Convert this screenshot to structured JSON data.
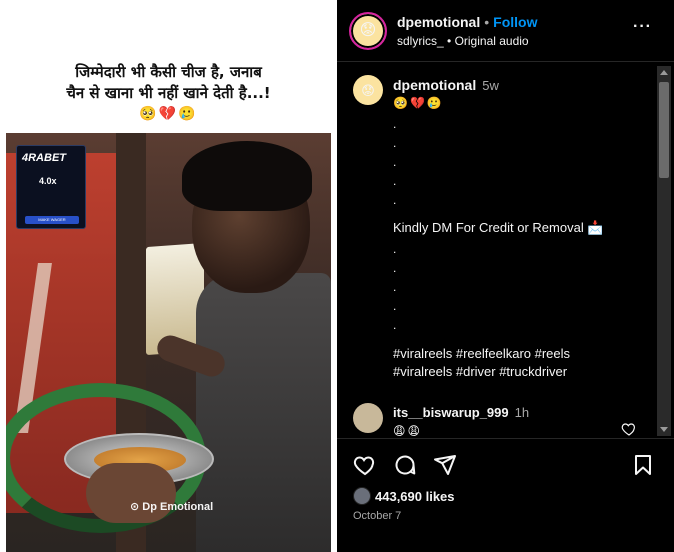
{
  "post": {
    "caption_line1": "जिम्मेदारी भी कैसी चीज है, जनाब",
    "caption_line2": "चैन से खाना भी नहीं खाने देती है...!",
    "caption_emojis": "🥺💔🥲",
    "ad_brand": "4RABET",
    "ad_multiplier": "4.0x",
    "ad_button": "MAKE WAGER",
    "watermark": "Dp Emotional"
  },
  "header": {
    "username": "dpemotional",
    "follow_label": "Follow",
    "audio_author": "sdlyrics_",
    "audio_label": "Original audio",
    "more_label": "···"
  },
  "caption_comment": {
    "username": "dpemotional",
    "time": "5w",
    "emojis": "🥺💔🥲",
    "dots_top": [
      ".",
      ".",
      ".",
      ".",
      "."
    ],
    "dm_text": "Kindly DM For Credit or Removal 📩",
    "dots_bottom": [
      ".",
      ".",
      ".",
      ".",
      "."
    ],
    "hashtags_line1": "#viralreels #reelfeelkaro #reels",
    "hashtags_line2": "#viralreels #driver #truckdriver"
  },
  "comment": {
    "username": "its__biswarup_999",
    "time": "1h",
    "emojis": "😩😩"
  },
  "footer": {
    "likes": "443,690 likes",
    "date": "October 7"
  },
  "colors": {
    "accent": "#0095f6",
    "panel_bg": "#000000",
    "muted": "#a8a8a8"
  },
  "icons": [
    "heart-icon",
    "comment-icon",
    "share-icon",
    "save-icon",
    "more-icon"
  ]
}
